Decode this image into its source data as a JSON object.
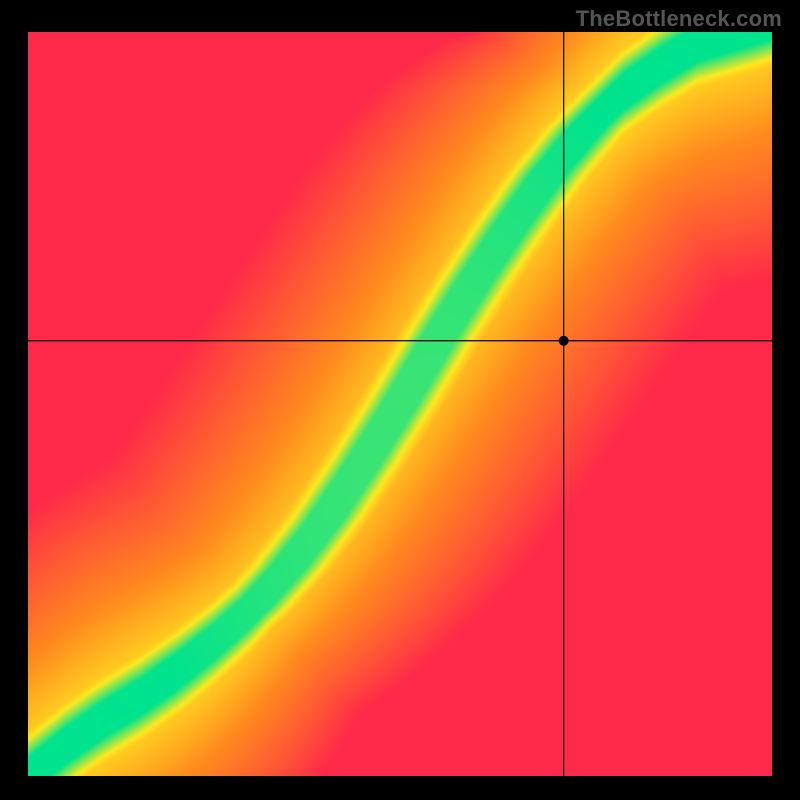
{
  "watermark": "TheBottleneck.com",
  "colors": {
    "red": "#ff2a4a",
    "orange": "#ff8a1f",
    "yellow": "#ffe91f",
    "green": "#00e38e",
    "crosshair": "#000000",
    "marker": "#000000",
    "background": "#000000"
  },
  "chart_data": {
    "type": "heatmap",
    "title": "",
    "xlabel": "",
    "ylabel": "",
    "x_range": [
      0,
      1
    ],
    "y_range": [
      0,
      1
    ],
    "crosshair": {
      "x": 0.72,
      "y": 0.585
    },
    "marker": {
      "x": 0.72,
      "y": 0.585,
      "radius_px": 5
    },
    "optimal_curve_points": [
      {
        "x": 0.0,
        "y": 0.0
      },
      {
        "x": 0.05,
        "y": 0.04
      },
      {
        "x": 0.1,
        "y": 0.075
      },
      {
        "x": 0.15,
        "y": 0.105
      },
      {
        "x": 0.2,
        "y": 0.14
      },
      {
        "x": 0.25,
        "y": 0.18
      },
      {
        "x": 0.3,
        "y": 0.225
      },
      {
        "x": 0.35,
        "y": 0.28
      },
      {
        "x": 0.4,
        "y": 0.345
      },
      {
        "x": 0.45,
        "y": 0.42
      },
      {
        "x": 0.5,
        "y": 0.5
      },
      {
        "x": 0.55,
        "y": 0.585
      },
      {
        "x": 0.6,
        "y": 0.665
      },
      {
        "x": 0.65,
        "y": 0.74
      },
      {
        "x": 0.7,
        "y": 0.81
      },
      {
        "x": 0.75,
        "y": 0.87
      },
      {
        "x": 0.8,
        "y": 0.92
      },
      {
        "x": 0.85,
        "y": 0.955
      },
      {
        "x": 0.9,
        "y": 0.985
      },
      {
        "x": 0.95,
        "y": 1.0
      }
    ],
    "band_half_width_normalized": 0.06,
    "note": "Color = closeness to a balanced pairing. Green = near the optimal curve; yellow/orange = moderate imbalance; red = large imbalance. Upper-left is GPU-limited, lower-right is CPU-limited."
  }
}
